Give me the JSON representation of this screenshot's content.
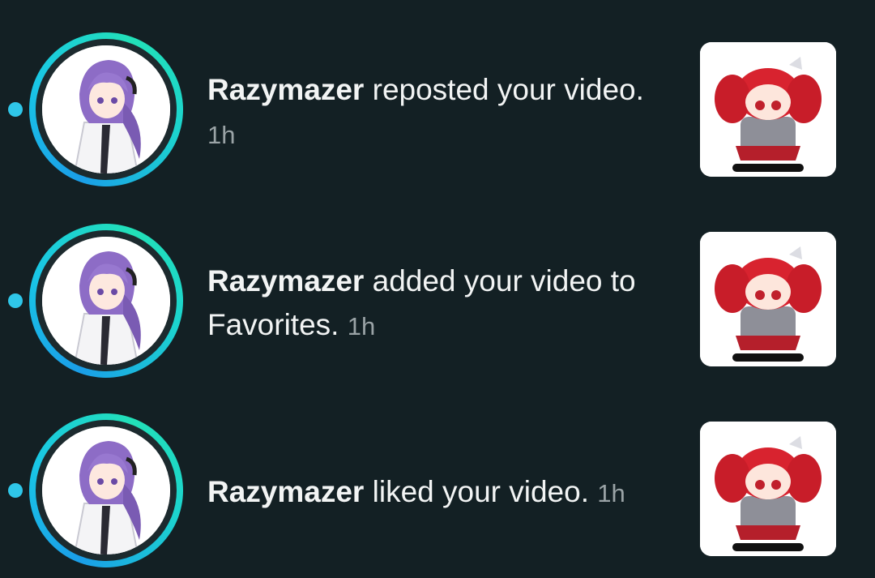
{
  "notifications": [
    {
      "username": "Razymazer",
      "action": "reposted your video.",
      "time": "1h",
      "avatar_icon": "user-avatar-purple-hair",
      "thumbnail_icon": "red-hair-plush-thumbnail",
      "unread": true
    },
    {
      "username": "Razymazer",
      "action": "added your video to Favorites.",
      "time": "1h",
      "avatar_icon": "user-avatar-purple-hair",
      "thumbnail_icon": "red-hair-plush-thumbnail",
      "unread": true
    },
    {
      "username": "Razymazer",
      "action": "liked your video.",
      "time": "1h",
      "avatar_icon": "user-avatar-purple-hair",
      "thumbnail_icon": "red-hair-plush-thumbnail",
      "unread": true
    }
  ],
  "colors": {
    "background": "#132024",
    "unread_dot": "#2fc6e8",
    "ring_start": "#1a9ee8",
    "ring_end": "#22e0b8",
    "text": "#f2f4f4",
    "timestamp": "#9aa3a6"
  }
}
